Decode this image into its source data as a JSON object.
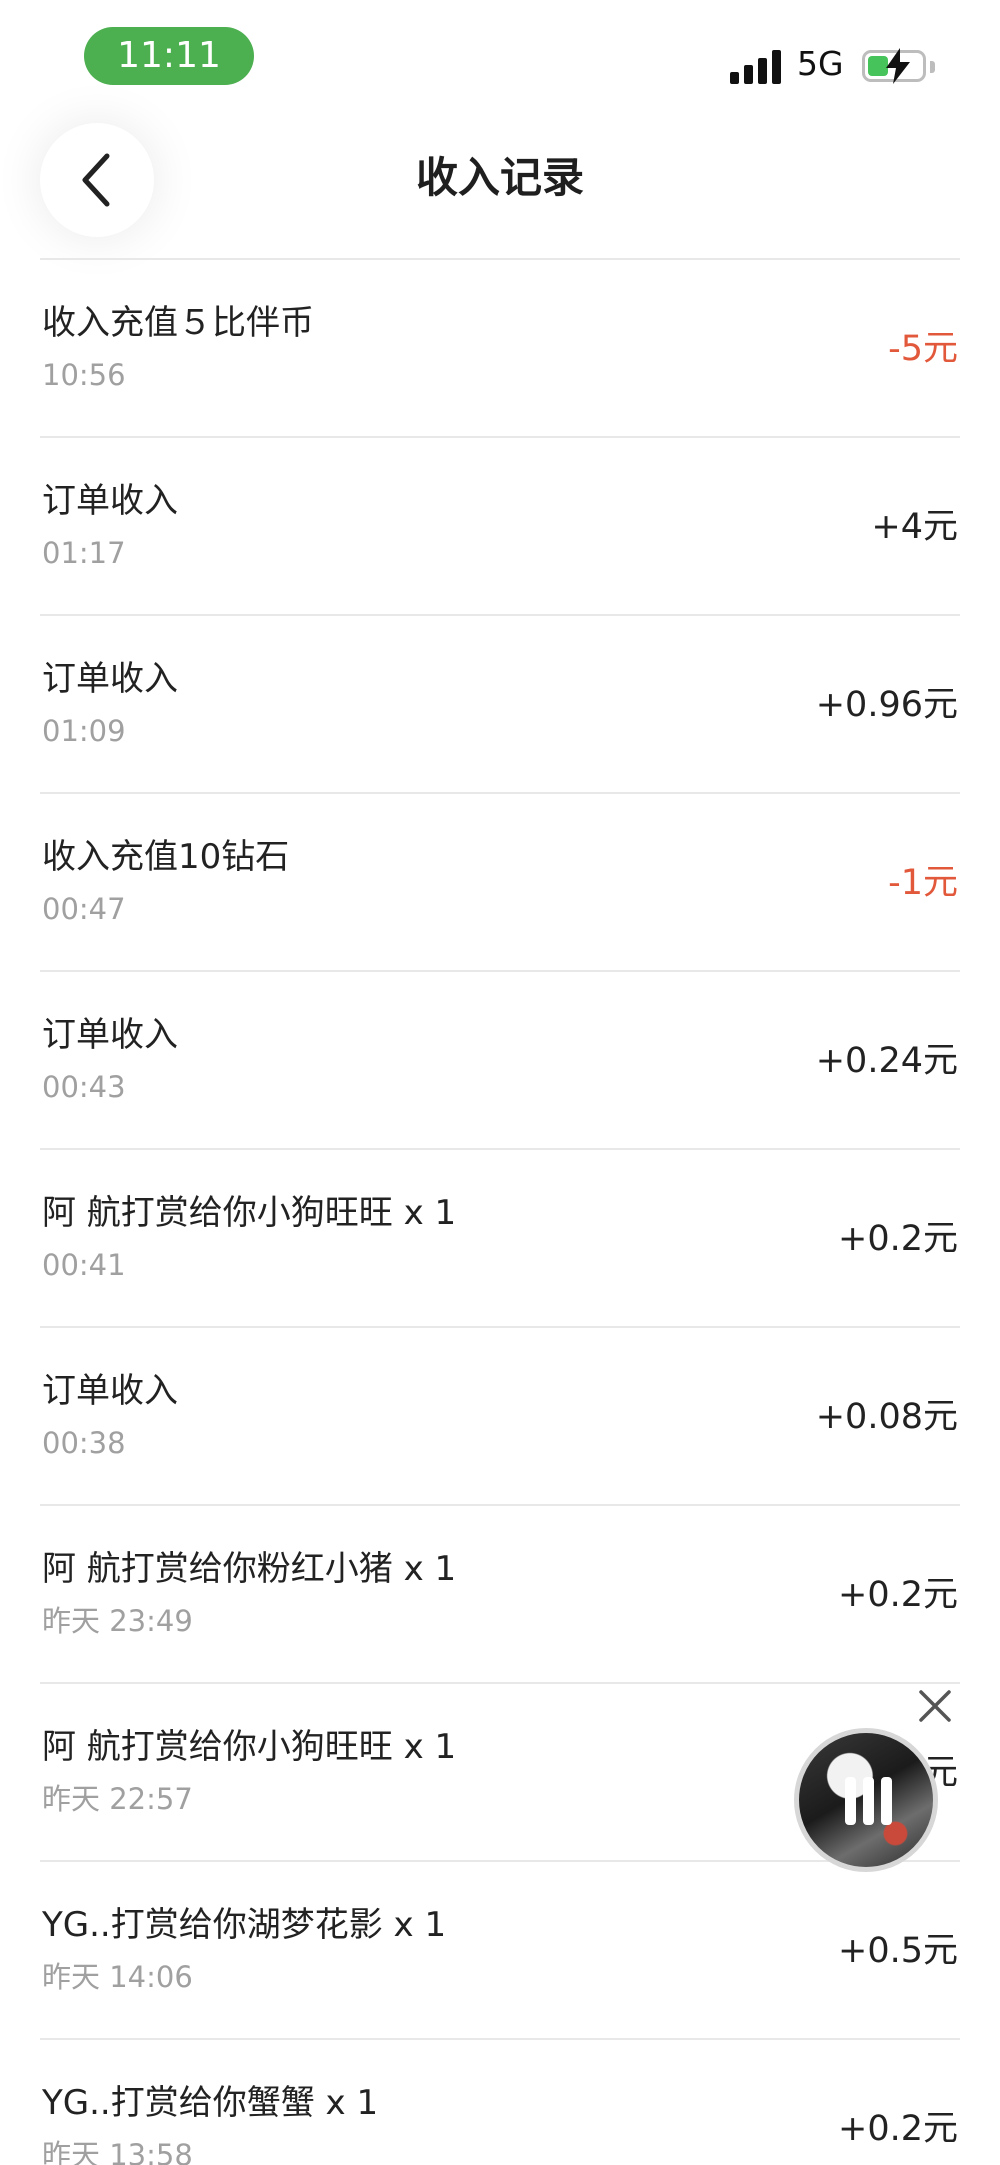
{
  "status_bar": {
    "time": "11:11",
    "network": "5G"
  },
  "header": {
    "title": "收入记录"
  },
  "records": [
    {
      "title": "收入充值５比伴币",
      "time": "10:56",
      "amount": "-5元",
      "type": "expense"
    },
    {
      "title": "订单收入",
      "time": "01:17",
      "amount": "+4元",
      "type": "income"
    },
    {
      "title": "订单收入",
      "time": "01:09",
      "amount": "+0.96元",
      "type": "income"
    },
    {
      "title": "收入充值10钻石",
      "time": "00:47",
      "amount": "-1元",
      "type": "expense"
    },
    {
      "title": "订单收入",
      "time": "00:43",
      "amount": "+0.24元",
      "type": "income"
    },
    {
      "title": "阿 航打赏给你小狗旺旺 x 1",
      "time": "00:41",
      "amount": "+0.2元",
      "type": "income"
    },
    {
      "title": "订单收入",
      "time": "00:38",
      "amount": "+0.08元",
      "type": "income"
    },
    {
      "title": "阿 航打赏给你粉红小猪 x 1",
      "time": "昨天 23:49",
      "amount": "+0.2元",
      "type": "income"
    },
    {
      "title": "阿 航打赏给你小狗旺旺 x 1",
      "time": "昨天 22:57",
      "amount": "元",
      "type": "income"
    },
    {
      "title": "YG..打赏给你湖梦花影 x 1",
      "time": "昨天 14:06",
      "amount": "+0.5元",
      "type": "income"
    },
    {
      "title": "YG..打赏给你蟹蟹 x 1",
      "time": "昨天 13:58",
      "amount": "+0.2元",
      "type": "income"
    }
  ],
  "colors": {
    "accent_green": "#4caf50",
    "expense_red": "#e2583b",
    "text_primary": "#222222",
    "text_secondary": "#a0a0a0",
    "divider": "#e8e8e8"
  },
  "icons": {
    "back": "chevron-left-icon",
    "close_player": "close-icon",
    "pause": "pause-icon"
  }
}
